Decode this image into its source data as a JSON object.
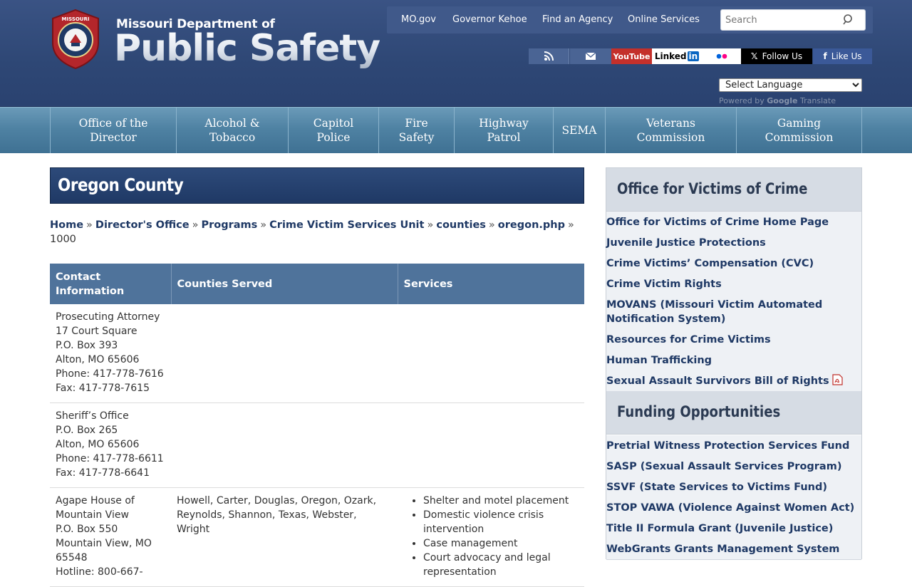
{
  "header": {
    "logo_top": "Missouri Department of",
    "logo_main": "Public Safety",
    "seal_text": "MISSOURI · DEPARTMENT OF PUBLIC SAFETY",
    "util_links": [
      "MO.gov",
      "Governor Kehoe",
      "Find an Agency",
      "Online Services"
    ],
    "search_placeholder": "Search",
    "social": {
      "youtube": "YouTube",
      "linkedin": "Linked",
      "linkedin_in": "in",
      "x_follow": "Follow Us",
      "facebook_like": "Like Us"
    },
    "language_select": "Select Language",
    "powered_by": "Powered by",
    "google": "Google",
    "translate": "Translate"
  },
  "nav": {
    "items": [
      "Office of the Director",
      "Alcohol & Tobacco",
      "Capitol Police",
      "Fire Safety",
      "Highway Patrol",
      "SEMA",
      "Veterans Commission",
      "Gaming Commission"
    ]
  },
  "main": {
    "title": "Oregon County",
    "breadcrumb": [
      "Home",
      "Director's Office",
      "Programs",
      "Crime Victim Services Unit",
      "counties",
      "oregon.php"
    ],
    "breadcrumb_tail": "1000",
    "table": {
      "headers": [
        "Contact Information",
        "Counties Served",
        "Services"
      ],
      "rows": [
        {
          "contact": [
            "Prosecuting Attorney",
            "17 Court Square",
            "P.O. Box 393",
            "Alton, MO 65606",
            "Phone: 417-778-7616",
            "Fax: 417-778-7615"
          ],
          "counties": "",
          "services": []
        },
        {
          "contact": [
            "Sheriff’s Office",
            "P.O. Box 265",
            "Alton, MO 65606",
            "Phone: 417-778-6611",
            "Fax: 417-778-6641"
          ],
          "counties": "",
          "services": []
        },
        {
          "contact": [
            "Agape House of Mountain View",
            "P.O. Box 550",
            "Mountain View, MO 65548",
            "Hotline: 800-667-"
          ],
          "counties": "Howell, Carter, Douglas, Oregon, Ozark, Reynolds, Shannon, Texas, Webster, Wright",
          "services": [
            "Shelter and motel placement",
            "Domestic violence crisis intervention",
            "Case management",
            "Court advocacy and legal representation"
          ]
        }
      ]
    }
  },
  "sidebar": {
    "sections": [
      {
        "title": "Office for Victims of Crime",
        "links": [
          "Office for Victims of Crime Home Page",
          "Juvenile Justice Protections",
          "Crime Victims’ Compensation (CVC)",
          "Crime Victim Rights",
          "MOVANS (Missouri Victim Automated Notification System)",
          "Resources for Crime Victims",
          "Human Trafficking",
          "Sexual Assault Survivors Bill of Rights"
        ]
      },
      {
        "title": "Funding Opportunities",
        "links": [
          "Pretrial Witness Protection Services Fund",
          "SASP (Sexual Assault Services Program)",
          "SSVF (State Services to Victims Fund)",
          "STOP VAWA (Violence Against Women Act)",
          "Title II Formula Grant (Juvenile Justice)",
          "WebGrants Grants Management System"
        ]
      }
    ]
  },
  "colors": {
    "header_bg": "#2e4775",
    "nav_bg": "#4f82a3",
    "title_bar": "#1f3965",
    "table_header": "#4f739b",
    "link": "#1f3965",
    "sidebar_head": "#d6dce4",
    "sidebar_link_bg": "#eef1f5"
  },
  "icons": [
    "seal-icon",
    "search-icon",
    "rss-icon",
    "email-icon",
    "youtube-icon",
    "linkedin-icon",
    "flickr-icon",
    "x-icon",
    "facebook-icon",
    "pdf-icon"
  ]
}
